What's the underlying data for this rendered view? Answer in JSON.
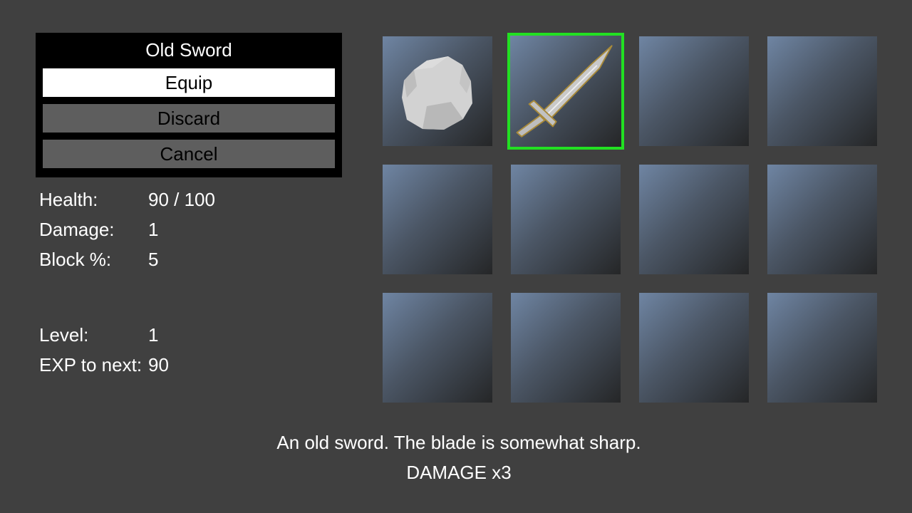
{
  "item_menu": {
    "title": "Old Sword",
    "buttons": [
      {
        "label": "Equip",
        "selected": true
      },
      {
        "label": "Discard",
        "selected": false
      },
      {
        "label": "Cancel",
        "selected": false
      }
    ]
  },
  "stats": {
    "health": {
      "label": "Health:",
      "value": "90 / 100"
    },
    "damage": {
      "label": "Damage:",
      "value": "1"
    },
    "block": {
      "label": "Block %:",
      "value": "5"
    },
    "level": {
      "label": "Level:",
      "value": "1"
    },
    "exp": {
      "label": "EXP to next:",
      "value": "90"
    }
  },
  "inventory": {
    "slots": [
      {
        "item": "rock-icon",
        "selected": false
      },
      {
        "item": "sword-icon",
        "selected": true
      },
      {
        "item": null,
        "selected": false
      },
      {
        "item": null,
        "selected": false
      },
      {
        "item": null,
        "selected": false
      },
      {
        "item": null,
        "selected": false
      },
      {
        "item": null,
        "selected": false
      },
      {
        "item": null,
        "selected": false
      },
      {
        "item": null,
        "selected": false
      },
      {
        "item": null,
        "selected": false
      },
      {
        "item": null,
        "selected": false
      },
      {
        "item": null,
        "selected": false
      }
    ]
  },
  "description": {
    "line1": "An old sword. The blade is somewhat sharp.",
    "line2": "DAMAGE x3"
  },
  "colors": {
    "background": "#404040",
    "menu_background": "#000000",
    "button_selected": "#ffffff",
    "button_normal": "#5e5e5e",
    "selection_border": "#22e022"
  }
}
